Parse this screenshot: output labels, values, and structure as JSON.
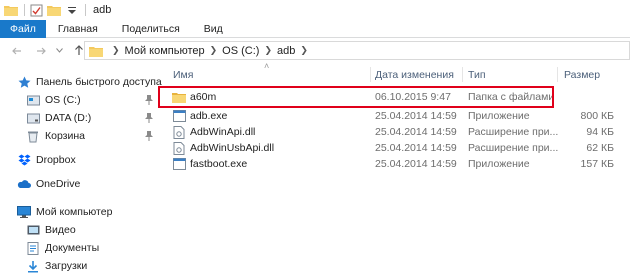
{
  "window": {
    "title": "adb"
  },
  "ribbon": {
    "tabs": [
      "Файл",
      "Главная",
      "Поделиться",
      "Вид"
    ]
  },
  "address": {
    "crumbs": [
      "Мой компьютер",
      "OS (C:)",
      "adb"
    ]
  },
  "sidebar": {
    "items": [
      {
        "label": "Панель быстрого доступа",
        "icon": "star-icon"
      },
      {
        "label": "OS (C:)",
        "icon": "drive-icon"
      },
      {
        "label": "DATA (D:)",
        "icon": "drive-icon"
      },
      {
        "label": "Корзина",
        "icon": "recycle-bin-icon"
      },
      {
        "label": "Dropbox",
        "icon": "dropbox-icon"
      },
      {
        "label": "OneDrive",
        "icon": "onedrive-icon"
      },
      {
        "label": "Мой компьютер",
        "icon": "computer-icon"
      },
      {
        "label": "Видео",
        "icon": "video-folder-icon"
      },
      {
        "label": "Документы",
        "icon": "documents-folder-icon"
      },
      {
        "label": "Загрузки",
        "icon": "downloads-folder-icon"
      }
    ]
  },
  "columns": {
    "name": "Имя",
    "date": "Дата изменения",
    "type": "Тип",
    "size": "Размер"
  },
  "files": [
    {
      "name": "a60m",
      "date": "06.10.2015 9:47",
      "type": "Папка с файлами",
      "size": "",
      "icon": "folder-icon"
    },
    {
      "name": "adb.exe",
      "date": "25.04.2014 14:59",
      "type": "Приложение",
      "size": "800 КБ",
      "icon": "exe-icon"
    },
    {
      "name": "AdbWinApi.dll",
      "date": "25.04.2014 14:59",
      "type": "Расширение при...",
      "size": "94 КБ",
      "icon": "dll-icon"
    },
    {
      "name": "AdbWinUsbApi.dll",
      "date": "25.04.2014 14:59",
      "type": "Расширение при...",
      "size": "62 КБ",
      "icon": "dll-icon"
    },
    {
      "name": "fastboot.exe",
      "date": "25.04.2014 14:59",
      "type": "Приложение",
      "size": "157 КБ",
      "icon": "exe-icon"
    }
  ],
  "colors": {
    "accent": "#1979ca",
    "highlight": "#e0001a",
    "folder": "#f4c95d"
  }
}
